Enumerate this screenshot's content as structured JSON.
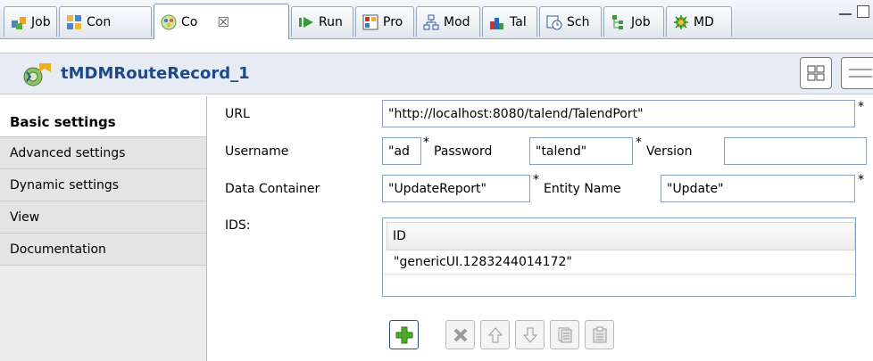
{
  "tabs": [
    {
      "label": "Job",
      "icon": "job-icon"
    },
    {
      "label": "Con",
      "icon": "context-icon"
    },
    {
      "label": "Co",
      "icon": "component-icon"
    },
    {
      "label": "Run",
      "icon": "run-icon"
    },
    {
      "label": "Pro",
      "icon": "problems-icon"
    },
    {
      "label": "Mod",
      "icon": "modules-icon"
    },
    {
      "label": "Tal",
      "icon": "talend-icon"
    },
    {
      "label": "Sch",
      "icon": "scheduler-icon"
    },
    {
      "label": "Job",
      "icon": "job-hierarchy-icon"
    },
    {
      "label": "MD",
      "icon": "mdm-icon"
    }
  ],
  "header": {
    "title": "tMDMRouteRecord_1"
  },
  "sidebar": {
    "items": [
      {
        "label": "Basic settings"
      },
      {
        "label": "Advanced settings"
      },
      {
        "label": "Dynamic settings"
      },
      {
        "label": "View"
      },
      {
        "label": "Documentation"
      }
    ]
  },
  "form": {
    "url_label": "URL",
    "url_value": "\"http://localhost:8080/talend/TalendPort\"",
    "username_label": "Username",
    "username_value": "\"ad",
    "password_label": "Password",
    "password_value": "\"talend\"",
    "version_label": "Version",
    "version_value": "",
    "container_label": "Data Container",
    "container_value": "\"UpdateReport\"",
    "entity_label": "Entity Name",
    "entity_value": "\"Update\"",
    "ids_label": "IDS:",
    "required_mark": "*"
  },
  "table": {
    "header": "ID",
    "rows": [
      "\"genericUI.1283244014172\""
    ]
  },
  "colors": {
    "title": "#1e4a8a",
    "header_bg": "#e7ecf4",
    "sidebar_bg": "#ebebeb",
    "field_border": "#8aa0bf"
  }
}
